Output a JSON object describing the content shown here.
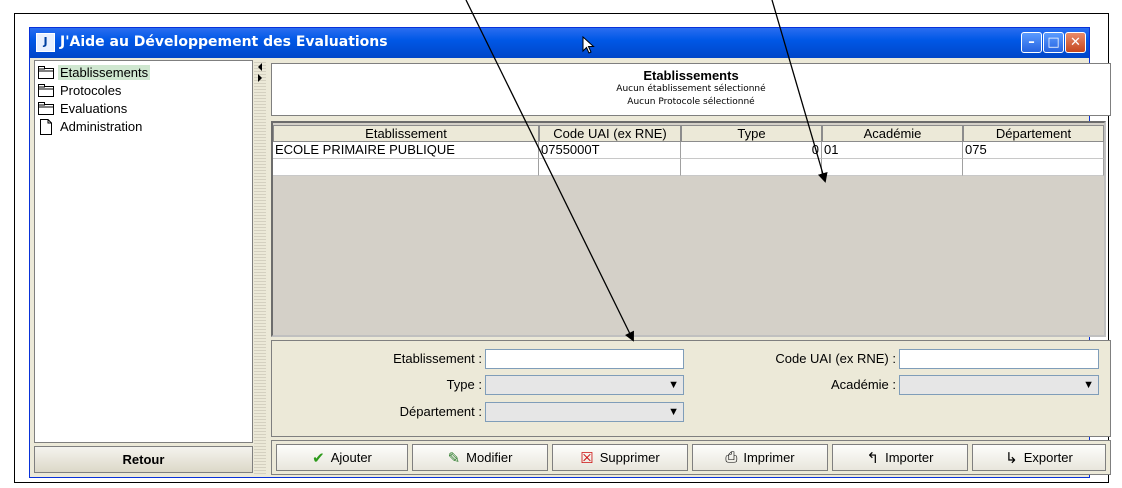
{
  "window": {
    "icon_glyph": "J",
    "title": "J'Aide au Développement des Evaluations",
    "buttons": {
      "minimize": "–",
      "maximize": "□",
      "close": "✕"
    }
  },
  "sidebar": {
    "items": [
      {
        "label": "Etablissements",
        "icon": "folder-icon"
      },
      {
        "label": "Protocoles",
        "icon": "folder-icon"
      },
      {
        "label": "Evaluations",
        "icon": "folder-icon"
      },
      {
        "label": "Administration",
        "icon": "document-icon"
      }
    ],
    "retour_label": "Retour"
  },
  "header": {
    "title": "Etablissements",
    "line1": "Aucun établissement sélectionné",
    "line2": "Aucun Protocole sélectionné"
  },
  "table": {
    "columns": [
      "Etablissement",
      "Code UAI (ex RNE)",
      "Type",
      "Académie",
      "Département"
    ],
    "rows": [
      [
        "ECOLE PRIMAIRE PUBLIQUE",
        "0755000T",
        "0",
        "01",
        "075"
      ],
      [
        "",
        "",
        "",
        "",
        ""
      ]
    ]
  },
  "form": {
    "etablissement_label": "Etablissement :",
    "etablissement_value": "",
    "code_label": "Code UAI (ex RNE) :",
    "code_value": "",
    "type_label": "Type :",
    "type_value": "",
    "academie_label": "Académie :",
    "academie_value": "",
    "departement_label": "Département :",
    "departement_value": ""
  },
  "actions": [
    {
      "label": "Ajouter",
      "icon": "check-icon",
      "glyph": "✔",
      "color": "#2c9a1a"
    },
    {
      "label": "Modifier",
      "icon": "edit-icon",
      "glyph": "✎",
      "color": "#2a7a2a"
    },
    {
      "label": "Supprimer",
      "icon": "delete-icon",
      "glyph": "☒",
      "color": "#cc1111"
    },
    {
      "label": "Imprimer",
      "icon": "printer-icon",
      "glyph": "⎙",
      "color": "#000000"
    },
    {
      "label": "Importer",
      "icon": "import-icon",
      "glyph": "↰",
      "color": "#000000"
    },
    {
      "label": "Exporter",
      "icon": "export-icon",
      "glyph": "↳",
      "color": "#000000"
    }
  ],
  "colors": {
    "titlebar": "#0058e6",
    "selection": "#cfe7d0",
    "panel": "#ece9d8",
    "table_bg": "#d4d0c8"
  }
}
